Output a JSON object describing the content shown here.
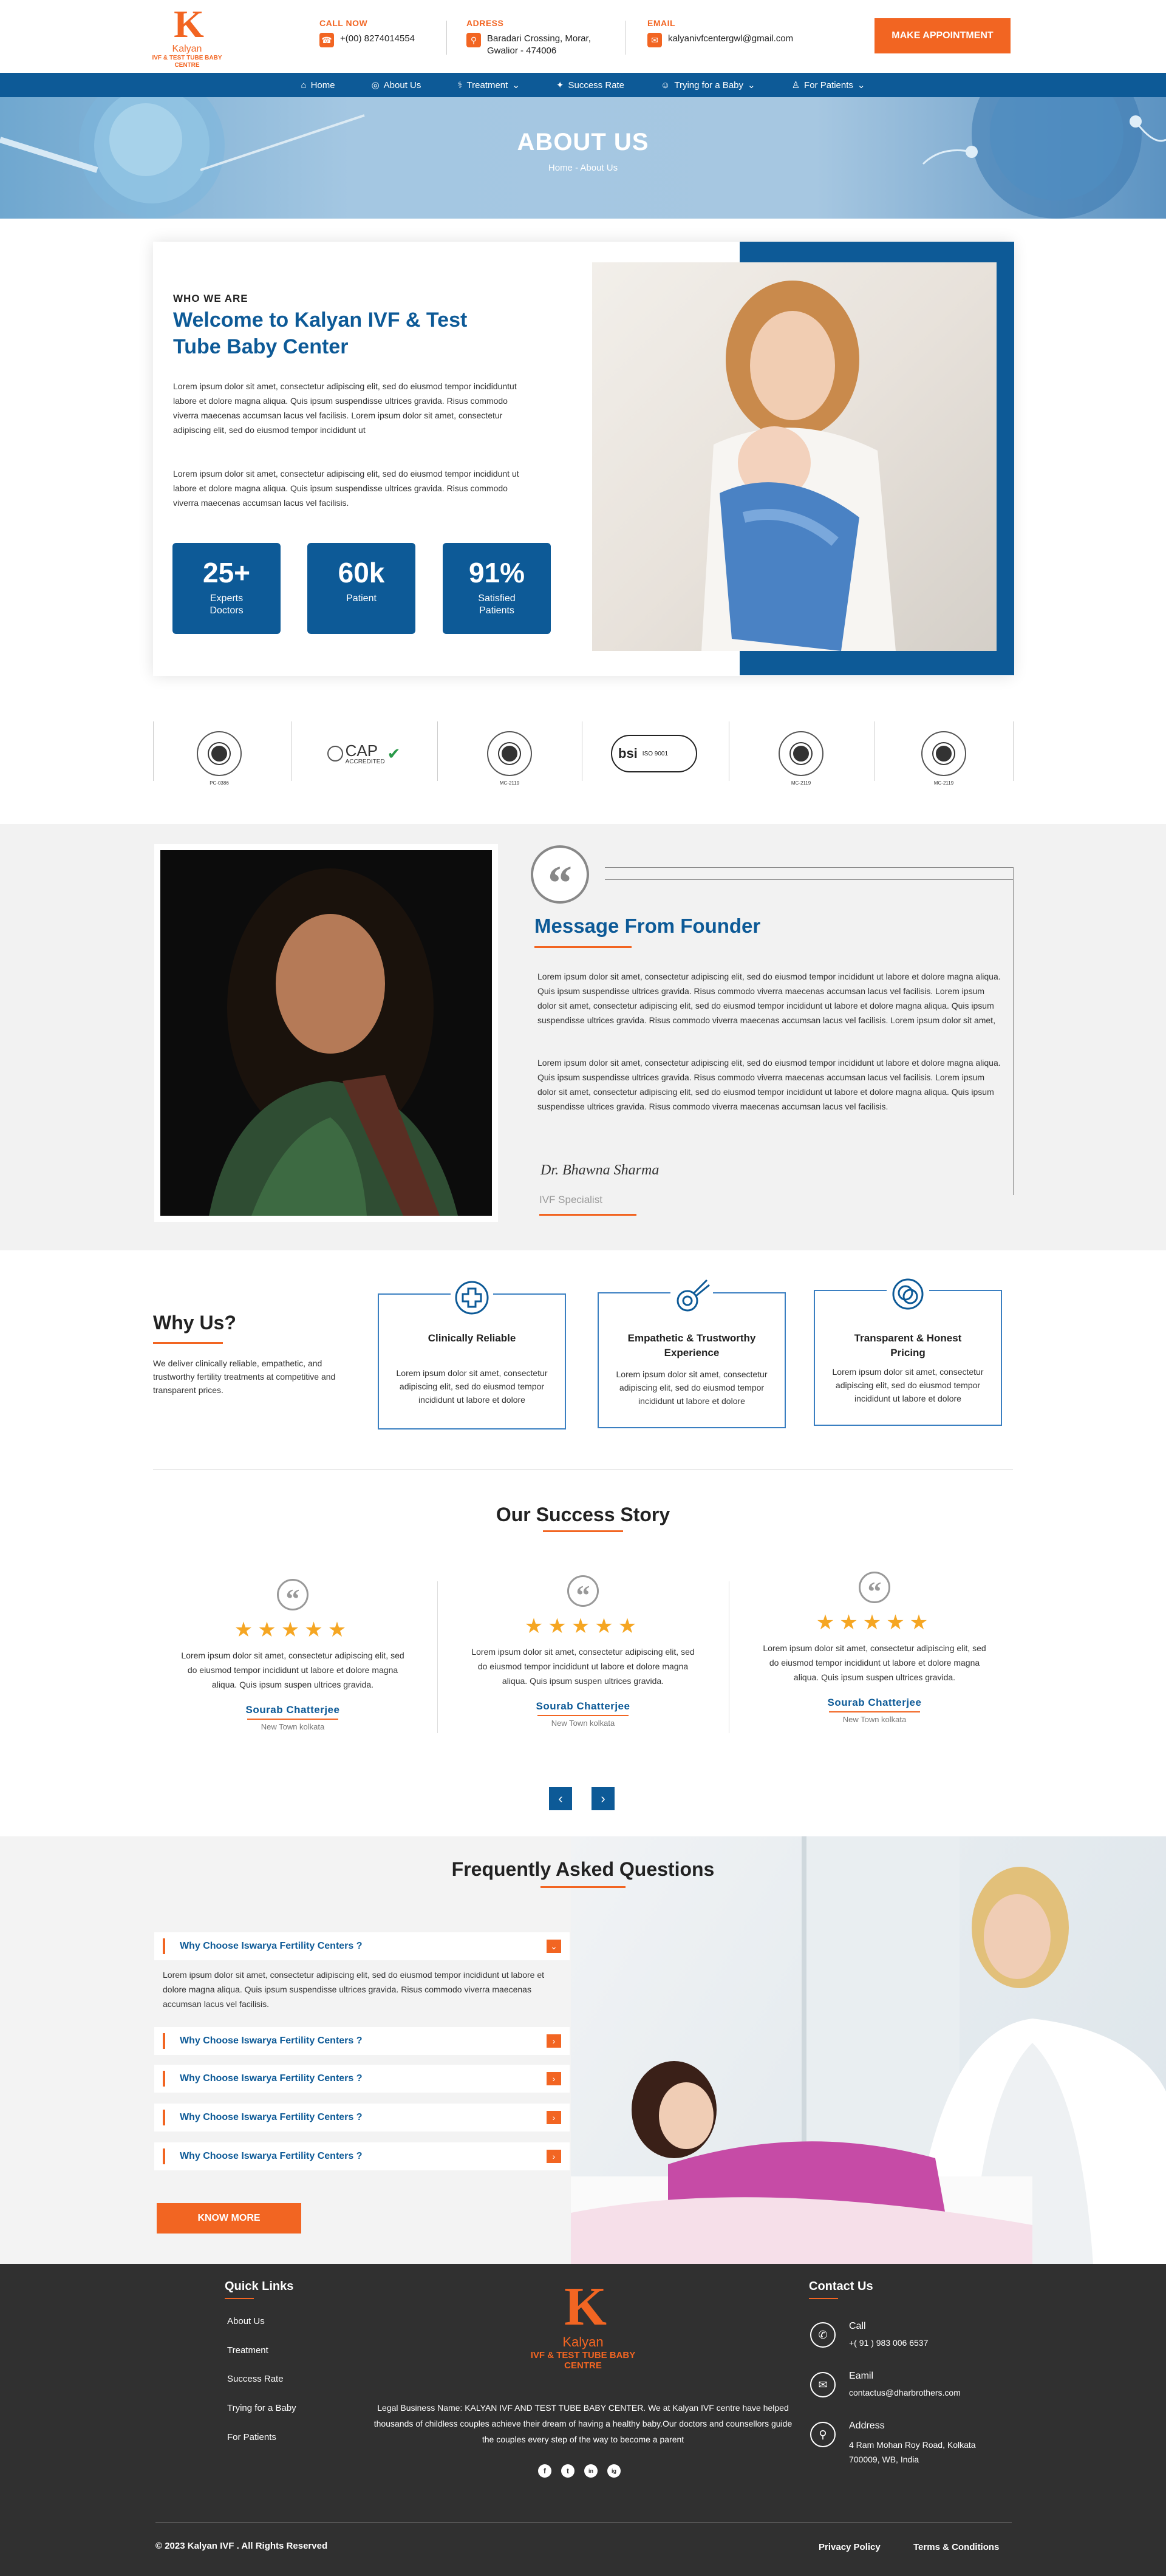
{
  "header": {
    "logo": {
      "mark": "K",
      "name": "Kalyan",
      "tagline": "IVF & TEST TUBE BABY CENTRE"
    },
    "call": {
      "label": "CALL NOW",
      "value": "+(00) 8274014554"
    },
    "address": {
      "label": "ADRESS",
      "line1": "Baradari Crossing, Morar,",
      "line2": "Gwalior - 474006"
    },
    "email": {
      "label": "EMAIL",
      "value": "kalyanivfcentergwl@gmail.com"
    },
    "cta": "MAKE APPOINTMENT"
  },
  "nav": {
    "items": [
      {
        "label": "Home",
        "icon": "home-icon"
      },
      {
        "label": "About Us",
        "icon": "handshake-icon"
      },
      {
        "label": "Treatment",
        "icon": "treatment-icon",
        "dropdown": "⌄"
      },
      {
        "label": "Success Rate",
        "icon": "success-icon"
      },
      {
        "label": "Trying for a Baby",
        "icon": "baby-icon",
        "dropdown": "⌄"
      },
      {
        "label": "For Patients",
        "icon": "patient-icon",
        "dropdown": "⌄"
      }
    ]
  },
  "hero": {
    "title": "ABOUT US",
    "breadcrumb": "Home - About Us"
  },
  "about": {
    "eyebrow": "WHO WE ARE",
    "title": "Welcome to Kalyan IVF & Test Tube Baby Center",
    "para1": "Lorem ipsum dolor sit amet, consectetur adipiscing elit, sed do eiusmod tempor incididuntut labore et dolore magna aliqua. Quis ipsum suspendisse ultrices gravida. Risus commodo viverra maecenas accumsan lacus vel facilisis. Lorem ipsum dolor sit amet, consectetur adipiscing elit, sed do eiusmod tempor incididunt ut",
    "para2": "Lorem ipsum dolor sit amet, consectetur adipiscing elit, sed do eiusmod tempor incididunt ut labore et dolore magna aliqua. Quis ipsum suspendisse ultrices gravida. Risus commodo viverra maecenas accumsan lacus vel facilisis.",
    "stats": [
      {
        "num": "25+",
        "label": "Experts Doctors"
      },
      {
        "num": "60k",
        "label": "Patient"
      },
      {
        "num": "91%",
        "label": "Satisfied Patients"
      }
    ]
  },
  "certs": {
    "c1": "PC-0386",
    "c2": "CAP",
    "c2sub": "ACCREDITED",
    "c3": "MC-2119",
    "c4": "bsi",
    "c4sub": "ISO 9001",
    "c5": "MC-2119",
    "c6": "MC-2119"
  },
  "founder": {
    "title": "Message From Founder",
    "para1": "Lorem ipsum dolor sit amet, consectetur adipiscing elit, sed do eiusmod tempor incididunt ut labore et dolore magna aliqua. Quis ipsum suspendisse ultrices gravida. Risus commodo viverra maecenas accumsan lacus vel facilisis. Lorem ipsum dolor sit amet, consectetur adipiscing elit, sed do eiusmod tempor incididunt ut labore et dolore magna aliqua. Quis ipsum suspendisse ultrices gravida. Risus commodo viverra maecenas accumsan lacus vel facilisis. Lorem ipsum dolor sit amet,",
    "para2": "Lorem ipsum dolor sit amet, consectetur adipiscing elit, sed do eiusmod tempor incididunt ut labore et dolore magna aliqua. Quis ipsum suspendisse ultrices gravida. Risus commodo viverra maecenas accumsan lacus vel facilisis. Lorem ipsum dolor sit amet, consectetur adipiscing elit, sed do eiusmod tempor incididunt ut labore et dolore magna aliqua. Quis ipsum suspendisse ultrices gravida. Risus commodo viverra maecenas accumsan lacus vel facilisis.",
    "signature": "Dr. Bhawna Sharma",
    "role": "IVF Specialist"
  },
  "why": {
    "title": "Why Us?",
    "desc": "We deliver clinically reliable, empathetic, and trustworthy fertility treatments at competitive and transparent prices.",
    "cards": [
      {
        "title": "Clinically Reliable",
        "desc": "Lorem ipsum dolor sit amet, consectetur adipiscing elit, sed do eiusmod tempor incididunt ut labore et dolore"
      },
      {
        "title": "Empathetic & Trustworthy Experience",
        "desc": "Lorem ipsum dolor sit amet, consectetur adipiscing elit, sed do eiusmod tempor incididunt ut labore et dolore"
      },
      {
        "title": "Transparent & Honest Pricing",
        "desc": "Lorem ipsum dolor sit amet, consectetur adipiscing elit, sed do eiusmod tempor incididunt ut labore et dolore"
      }
    ]
  },
  "success": {
    "title": "Our Success Story",
    "stars": "★★★★★",
    "items": [
      {
        "text": "Lorem ipsum dolor sit amet, consectetur adipiscing elit, sed do eiusmod tempor incididunt ut labore et dolore magna aliqua. Quis ipsum suspen ultrices gravida.",
        "name": "Sourab  Chatterjee",
        "loc": "New Town kolkata"
      },
      {
        "text": "Lorem ipsum dolor sit amet, consectetur adipiscing elit, sed do eiusmod tempor incididunt ut labore et dolore magna aliqua. Quis ipsum suspen ultrices gravida.",
        "name": "Sourab  Chatterjee",
        "loc": "New Town kolkata"
      },
      {
        "text": "Lorem ipsum dolor sit amet, consectetur adipiscing elit, sed do eiusmod tempor incididunt ut labore et dolore magna aliqua. Quis ipsum suspen ultrices gravida.",
        "name": "Sourab  Chatterjee",
        "loc": "New Town kolkata"
      }
    ],
    "prev": "‹",
    "next": "›"
  },
  "faq": {
    "title": "Frequently Asked Questions",
    "items": [
      {
        "q": "Why Choose Iswarya Fertility Centers ?",
        "toggle": "⌄",
        "answer": "Lorem ipsum dolor sit amet, consectetur adipiscing elit, sed do eiusmod tempor incididunt ut labore et dolore magna aliqua. Quis ipsum suspendisse ultrices gravida. Risus commodo viverra maecenas accumsan lacus vel facilisis."
      },
      {
        "q": "Why Choose Iswarya Fertility Centers ?",
        "toggle": "›"
      },
      {
        "q": "Why Choose Iswarya Fertility Centers ?",
        "toggle": "›"
      },
      {
        "q": "Why Choose Iswarya Fertility Centers ?",
        "toggle": "›"
      },
      {
        "q": "Why Choose Iswarya Fertility Centers ?",
        "toggle": "›"
      }
    ],
    "button": "KNOW MORE"
  },
  "footer": {
    "quickTitle": "Quick Links",
    "links": [
      "About Us",
      "Treatment",
      "Success Rate",
      "Trying for a Baby",
      "For Patients"
    ],
    "logo": {
      "mark": "K",
      "name": "Kalyan",
      "tagline1": "IVF & TEST TUBE BABY",
      "tagline2": "CENTRE"
    },
    "legal": "Legal Business Name: KALYAN IVF AND TEST TUBE BABY CENTER. We at Kalyan IVF centre have helped thousands of childless couples achieve their dream of having a healthy baby.Our doctors and counsellors guide the couples every step of the way to become a parent",
    "social": [
      "f",
      "t",
      "in",
      "ig"
    ],
    "contactTitle": "Contact Us",
    "call": {
      "label": "Call",
      "value": "+( 91 ) 983 006 6537"
    },
    "email": {
      "label": "Eamil",
      "value": "contactus@dharbrothers.com"
    },
    "address": {
      "label": "Address",
      "line1": "4 Ram Mohan Roy Road, Kolkata",
      "line2": "700009, WB, India"
    },
    "copyright": "© 2023 Kalyan IVF . All Rights Reserved",
    "privacy": "Privacy Policy",
    "terms": "Terms & Conditions"
  },
  "colors": {
    "brandBlue": "#0d5a97",
    "brandOrange": "#f26522",
    "footerBg": "#303030",
    "star": "#f5a623"
  }
}
